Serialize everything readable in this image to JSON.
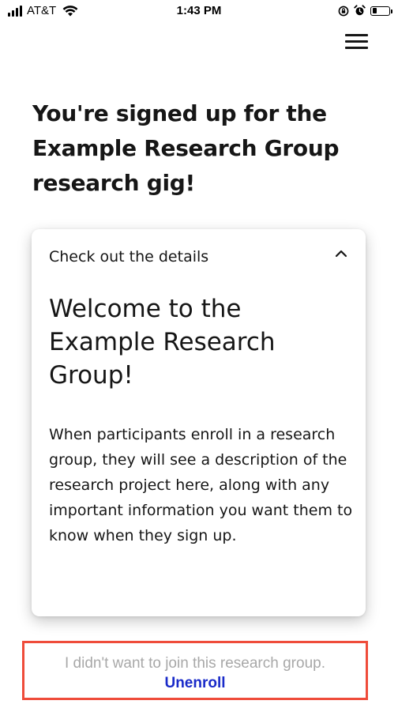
{
  "status_bar": {
    "carrier": "AT&T",
    "time": "1:43 PM",
    "icons": [
      "signal-icon",
      "wifi-icon",
      "orientation-lock-icon",
      "alarm-icon",
      "battery-icon"
    ],
    "battery_level": 0.3
  },
  "header": {
    "menu_icon": "hamburger-menu-icon"
  },
  "main": {
    "title": "You're signed up for the Example Research Group research gig!"
  },
  "details_card": {
    "header_label": "Check out the details",
    "toggle_icon": "chevron-up-icon",
    "title": "Welcome to the Example Research Group!",
    "body": "When participants enroll in a research group, they will see a description of the research project here, along with any important information you want them to know when they sign up."
  },
  "unenroll": {
    "question": "I didn't want to join this research group.",
    "link_label": "Unenroll",
    "highlight_color": "#ef4c3a",
    "link_color": "#1a2bc9"
  }
}
